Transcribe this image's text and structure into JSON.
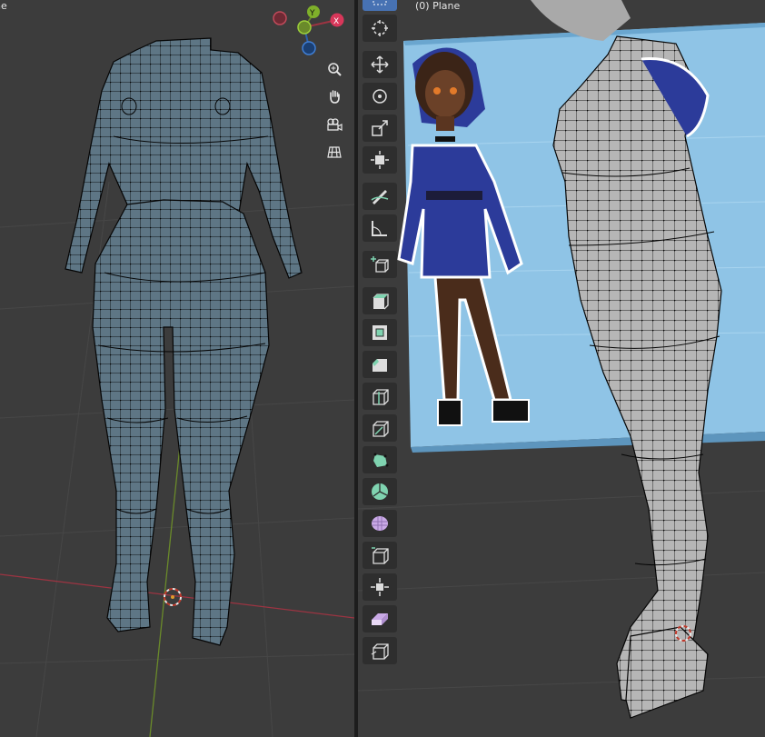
{
  "left_viewport": {
    "title": "ne",
    "gizmo": {
      "y_label": "Y",
      "x_label": "X"
    },
    "nav_buttons": [
      "zoom-icon",
      "pan-hand-icon",
      "camera-icon",
      "ortho-grid-icon"
    ]
  },
  "right_viewport": {
    "title": "(0) Plane",
    "tools": [
      "select-box-icon",
      "cursor-icon",
      "move-icon",
      "rotate-icon",
      "scale-icon",
      "transform-icon",
      "annotate-icon",
      "measure-icon",
      "add-cube-icon",
      "extrude-icon",
      "inset-icon",
      "bevel-icon",
      "loop-cut-icon",
      "knife-icon",
      "poly-build-icon",
      "spin-icon",
      "smooth-icon",
      "edge-slide-icon",
      "shrink-fatten-icon",
      "shear-icon",
      "rip-icon"
    ]
  },
  "colors": {
    "mesh_fill": "#5e7685",
    "mesh_wire": "#0a0a0a",
    "grid_bg": "#3c3c3c",
    "x_axis": "#9c3442",
    "y_axis": "#6a8a2a",
    "toolbar_bg": "#2e2e2e",
    "tool_active": "#4772b3",
    "reference_plane": "#8fc4e6",
    "side_mesh": "#b6b6b6"
  }
}
